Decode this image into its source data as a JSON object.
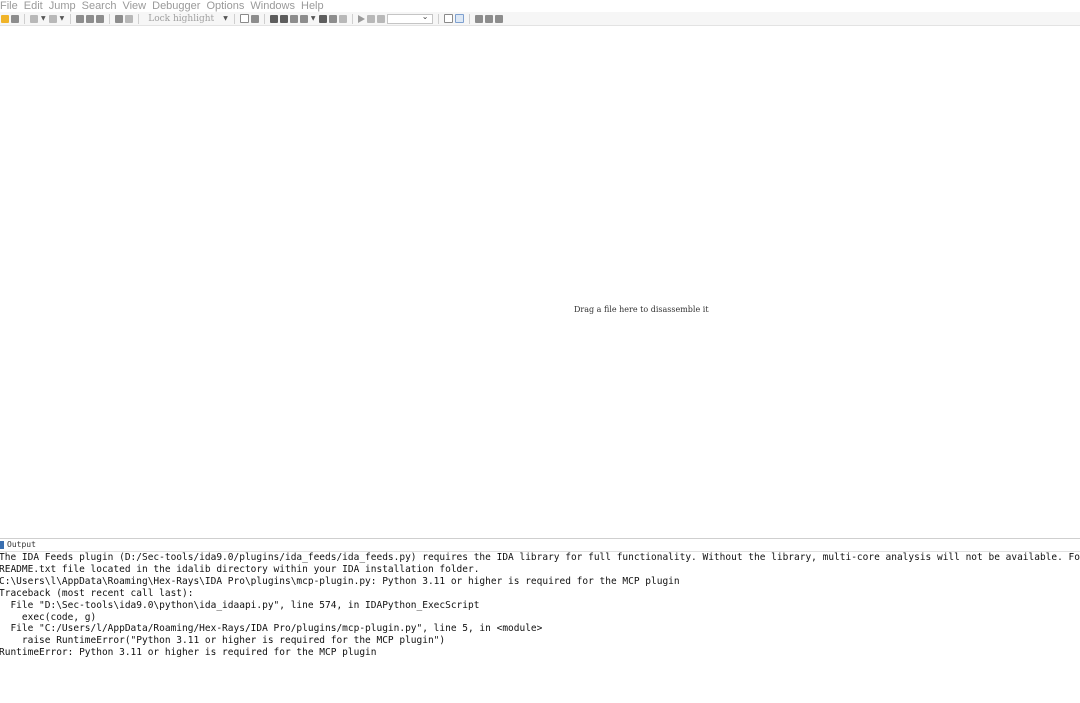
{
  "menu": [
    "File",
    "Edit",
    "Jump",
    "Search",
    "View",
    "Debugger",
    "Options",
    "Windows",
    "Help"
  ],
  "toolbar": {
    "lock_highlight_label": "Lock highlight",
    "debugger_combo_value": "",
    "icons": [
      "open-icon",
      "save-icon",
      "cut-icon",
      "copy-icon",
      "paste-icon",
      "find-icon",
      "find-next-icon",
      "jump-icon",
      "graph-icon",
      "play-icon",
      "pause-icon",
      "stop-icon"
    ]
  },
  "workspace": {
    "drop_hint": "Drag a file here to disassemble it"
  },
  "output": {
    "title": "Output",
    "lines": [
      "The IDA Feeds plugin (D:/Sec-tools/ida9.0/plugins/ida_feeds/ida_feeds.py) requires the IDA library for full functionality. Without the library, multi-core analysis will not be available. For",
      "README.txt file located in the idalib directory within your IDA installation folder.",
      "C:\\Users\\l\\AppData\\Roaming\\Hex-Rays\\IDA Pro\\plugins\\mcp-plugin.py: Python 3.11 or higher is required for the MCP plugin",
      "Traceback (most recent call last):",
      "  File \"D:\\Sec-tools\\ida9.0\\python\\ida_idaapi.py\", line 574, in IDAPython_ExecScript",
      "    exec(code, g)",
      "  File \"C:/Users/l/AppData/Roaming/Hex-Rays/IDA Pro/plugins/mcp-plugin.py\", line 5, in <module>",
      "    raise RuntimeError(\"Python 3.11 or higher is required for the MCP plugin\")",
      "RuntimeError: Python 3.11 or higher is required for the MCP plugin"
    ]
  }
}
